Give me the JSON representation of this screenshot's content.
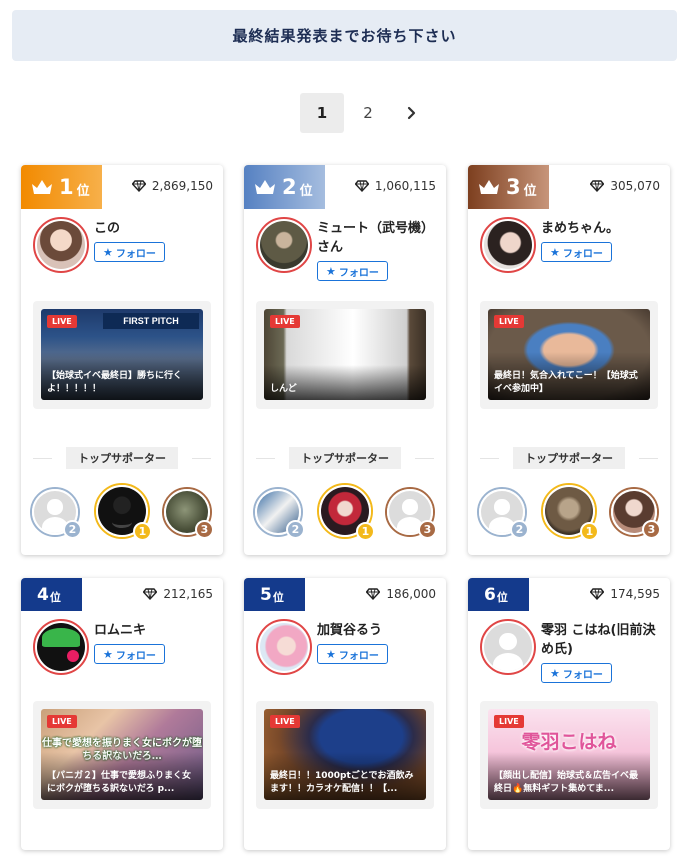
{
  "banner": {
    "text": "最終結果発表までお待ち下さい"
  },
  "pagination": {
    "pages": [
      "1",
      "2"
    ],
    "current": "1",
    "next_icon": "chevron-right-icon"
  },
  "rank_suffix": "位",
  "follow_label": "フォロー",
  "supporter_heading": "トップサポーター",
  "live_label": "LIVE",
  "colors": {
    "rank1": "#f08c00",
    "rank2": "#5d85c4",
    "rank3": "#8a4b2b",
    "rank_low": "#143a8c",
    "gold": "#f3b91b",
    "silver": "#9bb3cf",
    "bronze": "#a86a44",
    "live": "#e53935",
    "follow": "#1a73d9"
  },
  "cards": [
    {
      "rank": "1",
      "points": "2,869,150",
      "name": "この",
      "stream_title": "【始球式イベ最終日】勝ちに行くよ！！！！！",
      "supporters": [
        {
          "badge": "2"
        },
        {
          "badge": "1"
        },
        {
          "badge": "3"
        }
      ]
    },
    {
      "rank": "2",
      "points": "1,060,115",
      "name": "ミュート（武号機）さん",
      "stream_title": "しんど",
      "supporters": [
        {
          "badge": "2"
        },
        {
          "badge": "1"
        },
        {
          "badge": "3"
        }
      ]
    },
    {
      "rank": "3",
      "points": "305,070",
      "name": "まめちゃん。",
      "stream_title": "最終日！気合入れてこー！【始球式イベ参加中】",
      "supporters": [
        {
          "badge": "2"
        },
        {
          "badge": "1"
        },
        {
          "badge": "3"
        }
      ]
    },
    {
      "rank": "4",
      "points": "212,165",
      "name": "ロムニキ",
      "stream_title": "【パニガ２】仕事で愛想ふりまく女にボクが堕ちる訳ないだろ p...",
      "thumb_overlay": "仕事で愛想を振りまく女にボクが堕ちる訳ないだろ…"
    },
    {
      "rank": "5",
      "points": "186,000",
      "name": "加賀谷るう",
      "stream_title": "最終日！！1000ptごとでお酒飲みます！！カラオケ配信！！【..."
    },
    {
      "rank": "6",
      "points": "174,595",
      "name": "零羽 こはね(旧前決め氏)",
      "stream_title": "【顔出し配信】始球式＆広告イベ最終日🔥無料ギフト集めてま...",
      "thumb_overlay": "零羽こはね"
    }
  ]
}
